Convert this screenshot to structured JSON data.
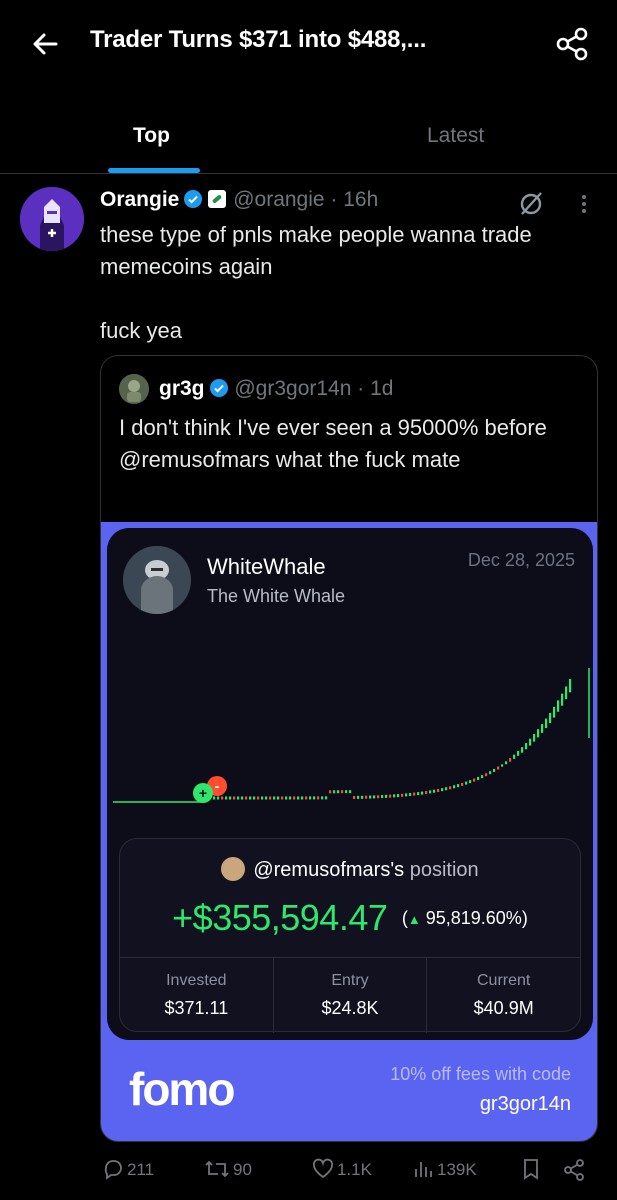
{
  "header": {
    "title": "Trader Turns $371 into $488,..."
  },
  "tabs": [
    {
      "label": "Top",
      "active": true
    },
    {
      "label": "Latest",
      "active": false
    }
  ],
  "post": {
    "author_name": "Orangie",
    "handle": "@orangie",
    "time": "· 16h",
    "body": "these type of pnls make people wanna trade memecoins again\n\nfuck yea"
  },
  "quote": {
    "author_name": "gr3g",
    "handle": "@gr3gor14n",
    "time": "· 1d",
    "body": "I don't think I've ever seen a 95000% before @remusofmars what the fuck mate",
    "card": {
      "name": "WhiteWhale",
      "subtitle": "The White Whale",
      "date": "Dec 28, 2025",
      "position_user": "@remusofmars's",
      "position_word": "position",
      "pnl": "+$355,594.47",
      "pnl_pct": "95,819.60%",
      "stats": [
        {
          "label": "Invested",
          "value": "$371.11"
        },
        {
          "label": "Entry",
          "value": "$24.8K"
        },
        {
          "label": "Current",
          "value": "$40.9M"
        }
      ],
      "brand": "fomo",
      "promo_line": "10% off fees with code",
      "promo_code": "gr3gor14n"
    }
  },
  "actions": {
    "replies": "211",
    "reposts": "90",
    "likes": "1.1K",
    "views": "139K"
  },
  "colors": {
    "accent": "#1d9bf0",
    "card_bg": "#5a64f0",
    "gain": "#2ee86b",
    "loss": "#ff4d2e"
  }
}
